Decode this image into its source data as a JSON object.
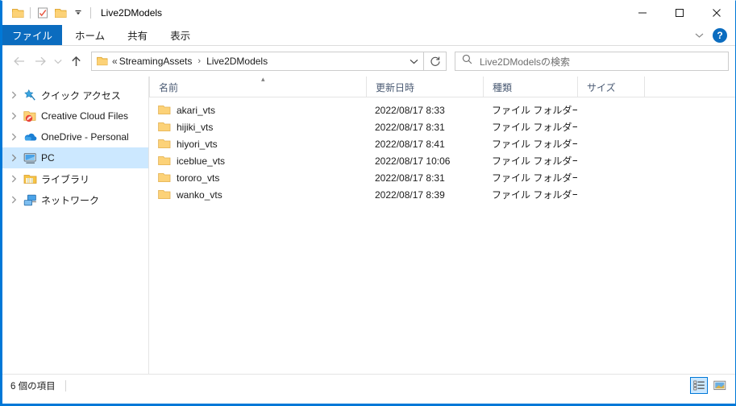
{
  "window": {
    "title": "Live2DModels",
    "accent_color": "#0078d7",
    "quick_access_icons": [
      "folder-icon",
      "properties-checkmark-icon",
      "new-folder-icon",
      "customize-qat-chevron-icon"
    ],
    "controls": {
      "minimize": "minimize-icon",
      "maximize": "maximize-icon",
      "close": "close-icon"
    }
  },
  "ribbon": {
    "tabs": [
      {
        "label": "ファイル",
        "active": true
      },
      {
        "label": "ホーム",
        "active": false
      },
      {
        "label": "共有",
        "active": false
      },
      {
        "label": "表示",
        "active": false
      }
    ],
    "collapse_icon": "chevron-down-icon",
    "help_label": "?"
  },
  "nav": {
    "back": "arrow-left-icon",
    "forward": "arrow-right-icon",
    "recent": "chevron-down-icon",
    "up": "arrow-up-icon",
    "refresh": "refresh-icon",
    "address": {
      "folder_icon": "folder-icon",
      "ellipsis": "«",
      "crumbs": [
        "StreamingAssets",
        "Live2DModels"
      ],
      "separator": "›",
      "dropdown_icon": "chevron-down-icon"
    }
  },
  "search": {
    "icon": "search-icon",
    "placeholder": "Live2DModelsの検索",
    "value": ""
  },
  "sidebar": {
    "items": [
      {
        "label": "クイック アクセス",
        "icon": "star-pin-icon",
        "selected": false
      },
      {
        "label": "Creative Cloud Files",
        "icon": "creative-cloud-icon",
        "selected": false
      },
      {
        "label": "OneDrive - Personal",
        "icon": "onedrive-cloud-icon",
        "selected": false
      },
      {
        "label": "PC",
        "icon": "this-pc-monitor-icon",
        "selected": true
      },
      {
        "label": "ライブラリ",
        "icon": "libraries-icon",
        "selected": false
      },
      {
        "label": "ネットワーク",
        "icon": "network-icon",
        "selected": false
      }
    ]
  },
  "filelist": {
    "columns": [
      {
        "label": "名前",
        "key": "name",
        "sorted": "asc"
      },
      {
        "label": "更新日時",
        "key": "date"
      },
      {
        "label": "種類",
        "key": "type"
      },
      {
        "label": "サイズ",
        "key": "size"
      }
    ],
    "rows": [
      {
        "name": "akari_vts",
        "date": "2022/08/17 8:33",
        "type": "ファイル フォルダー",
        "size": "",
        "icon": "folder-icon"
      },
      {
        "name": "hijiki_vts",
        "date": "2022/08/17 8:31",
        "type": "ファイル フォルダー",
        "size": "",
        "icon": "folder-icon"
      },
      {
        "name": "hiyori_vts",
        "date": "2022/08/17 8:41",
        "type": "ファイル フォルダー",
        "size": "",
        "icon": "folder-icon"
      },
      {
        "name": "iceblue_vts",
        "date": "2022/08/17 10:06",
        "type": "ファイル フォルダー",
        "size": "",
        "icon": "folder-icon"
      },
      {
        "name": "tororo_vts",
        "date": "2022/08/17 8:31",
        "type": "ファイル フォルダー",
        "size": "",
        "icon": "folder-icon"
      },
      {
        "name": "wanko_vts",
        "date": "2022/08/17 8:39",
        "type": "ファイル フォルダー",
        "size": "",
        "icon": "folder-icon"
      }
    ]
  },
  "statusbar": {
    "item_count_text": "6 個の項目",
    "views": [
      {
        "name": "details-view",
        "active": true
      },
      {
        "name": "large-icons-view",
        "active": false
      }
    ]
  }
}
